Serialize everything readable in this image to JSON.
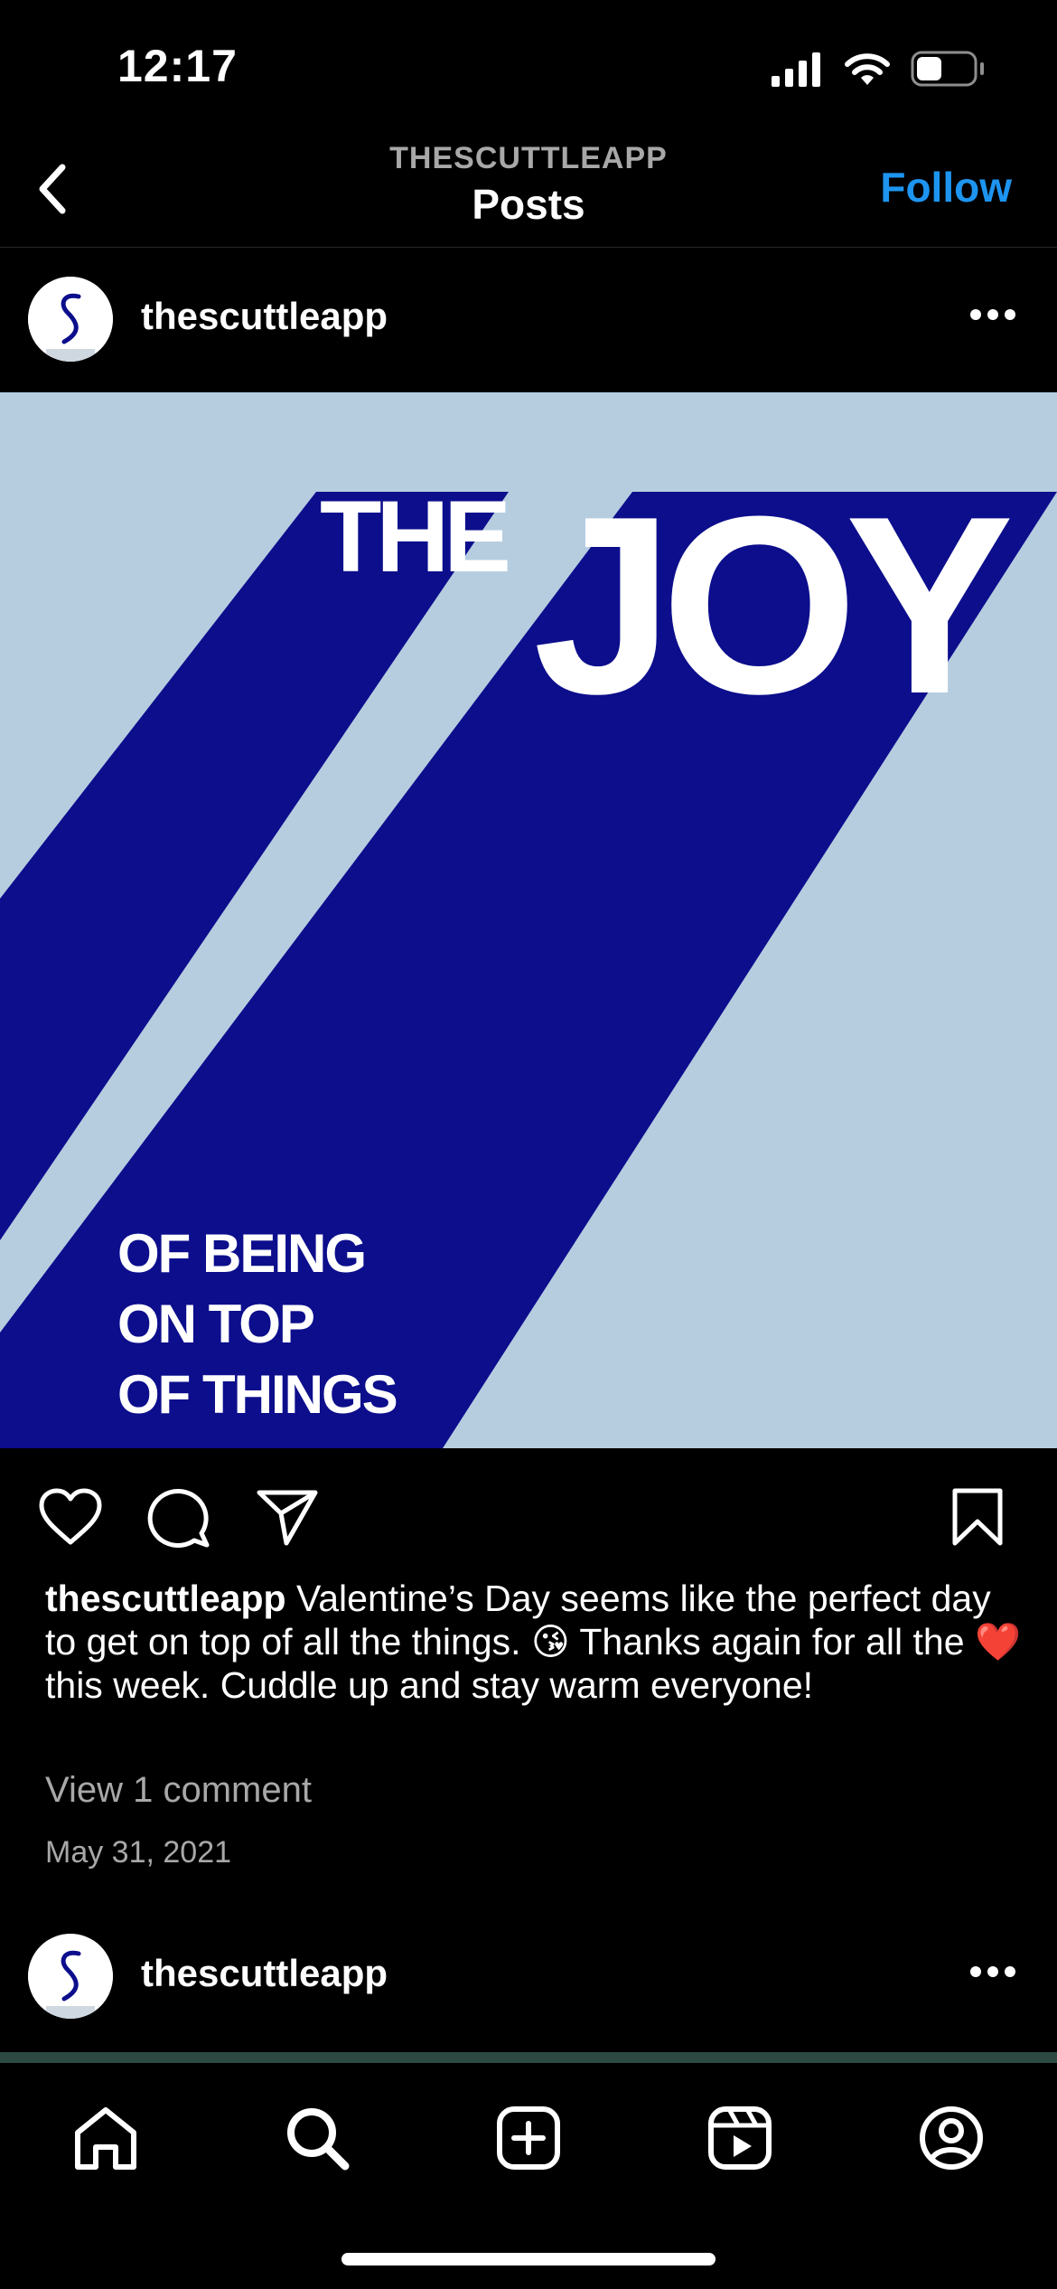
{
  "status_bar": {
    "time": "12:17",
    "icons": [
      "signal-icon",
      "wifi-icon",
      "battery-icon"
    ],
    "battery_level": 0.45
  },
  "nav": {
    "subtitle": "THESCUTTLEAPP",
    "title": "Posts",
    "follow_label": "Follow",
    "back_icon": "chevron-left-icon",
    "accent_color": "#1d95f0"
  },
  "post": {
    "username": "thescuttleapp",
    "more_icon": "more-horizontal-icon",
    "image": {
      "headline_small": "THE",
      "headline_large": "JOY",
      "sub_lines": [
        "OF BEING",
        "ON TOP",
        "OF THINGS"
      ],
      "background_color": "#b6cde0",
      "stripe_color": "#0c0e8c"
    },
    "actions": {
      "like_icon": "heart-icon",
      "comment_icon": "comment-icon",
      "share_icon": "send-icon",
      "save_icon": "bookmark-icon"
    },
    "caption_user": "thescuttleapp",
    "caption_text_1": " Valentine’s Day seems like the perfect day to get on top of all the things. ",
    "caption_emoji_1": "😘",
    "caption_text_2": " Thanks again for all the ",
    "caption_emoji_2": "❤️",
    "caption_text_3": " this week. Cuddle up and stay warm everyone!",
    "view_comments": "View 1 comment",
    "date": "May 31, 2021"
  },
  "next_post": {
    "username": "thescuttleapp"
  },
  "tab_bar": {
    "tabs": [
      "home-icon",
      "search-icon",
      "create-icon",
      "reels-icon",
      "profile-icon"
    ]
  }
}
